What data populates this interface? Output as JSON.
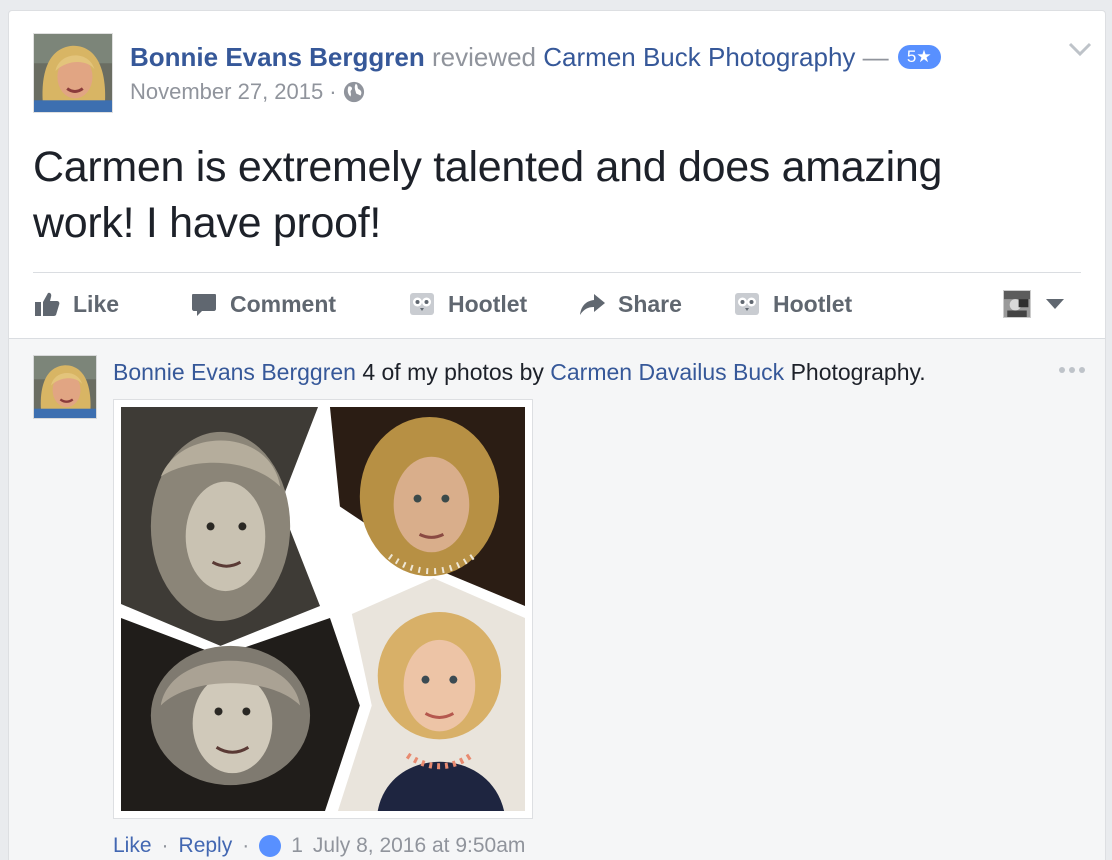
{
  "post": {
    "author": "Bonnie Evans Berggren",
    "action_word": "reviewed",
    "page_name": "Carmen Buck Photography",
    "dash": "—",
    "rating": "5★",
    "date": "November 27, 2015",
    "separator": "·",
    "body": "Carmen is extremely talented and does amazing work! I have proof!"
  },
  "actions": {
    "like": "Like",
    "comment": "Comment",
    "hootlet_1": "Hootlet",
    "share": "Share",
    "hootlet_2": "Hootlet"
  },
  "comment": {
    "author": "Bonnie Evans Berggren",
    "text_before": "4 of my photos by",
    "tagged": "Carmen Davailus Buck",
    "text_after": "Photography.",
    "meta_like": "Like",
    "meta_reply": "Reply",
    "meta_count": "1",
    "meta_date": "July 8, 2016 at 9:50am"
  },
  "colors": {
    "link": "#365899",
    "muted": "#90949c",
    "badge": "#5890ff",
    "action_text": "#606770"
  },
  "icons": {
    "chevron": "chevron-down-icon",
    "globe": "globe-icon",
    "like": "thumbs-up-icon",
    "comment": "comment-bubble-icon",
    "hootlet": "owl-icon",
    "share": "share-arrow-icon",
    "more": "ellipsis-icon"
  }
}
